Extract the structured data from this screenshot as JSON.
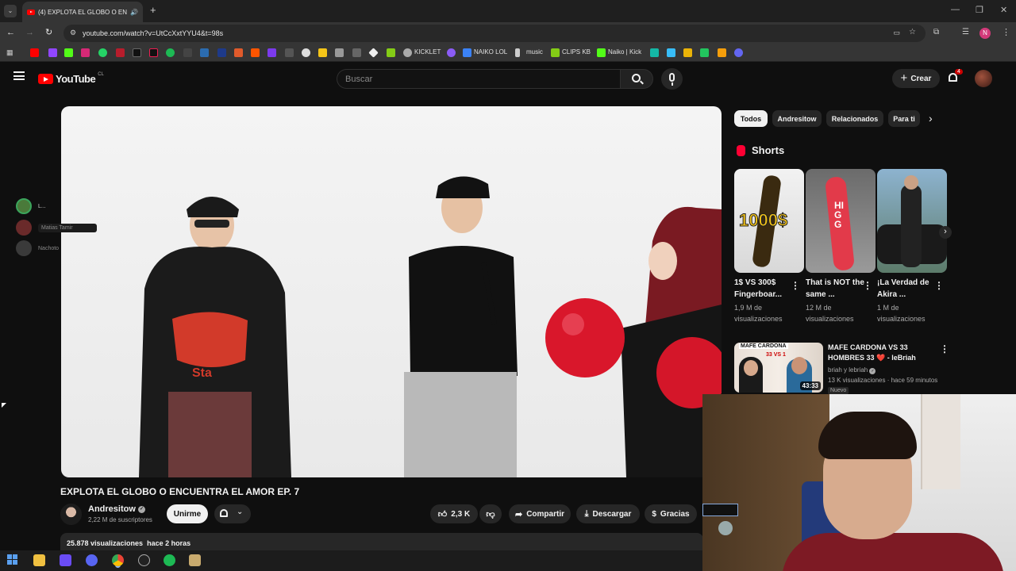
{
  "browser": {
    "tab_title": "(4) EXPLOTA EL GLOBO O EN",
    "url": "youtube.com/watch?v=UtCcXxtYYU4&t=98s",
    "profile_initial": "N",
    "bookmarks": [
      "KICKLET",
      "NAIKO LOL",
      "music",
      "CLIPS KB",
      "Naiko | Kick"
    ]
  },
  "youtube": {
    "logo_text": "YouTube",
    "region": "CL",
    "search_placeholder": "Buscar",
    "create_label": "Crear",
    "notification_count": "4"
  },
  "video": {
    "title": "EXPLOTA EL GLOBO O ENCUENTRA EL AMOR EP. 7",
    "channel": "Andresitow",
    "subscribers": "2,22 M de suscriptores",
    "join_label": "Unirme",
    "likes": "2,3 K",
    "share_label": "Compartir",
    "download_label": "Descargar",
    "thanks_label": "Gracias",
    "views": "25.878 visualizaciones",
    "published": "hace 2 horas"
  },
  "sidebar": {
    "chips": [
      "Todos",
      "Andresitow",
      "Relacionados",
      "Para ti"
    ],
    "shorts_heading": "Shorts",
    "shorts": [
      {
        "title": "1$ VS 300$ Fingerboar...",
        "views": "1,9 M de visualizaciones",
        "thumb_text": "1000$"
      },
      {
        "title": "That is NOT the same ...",
        "views": "12 M de visualizaciones",
        "thumb_text": "HIGG"
      },
      {
        "title": "¡La Verdad de Akira ...",
        "views": "1 M de visualizaciones",
        "thumb_text": ""
      }
    ],
    "recommended": {
      "title": "MAFE CARDONA VS 33 HOMBRES 33 ❤️ - leBriah",
      "channel": "briah y lebriah",
      "meta": "13 K visualizaciones · hace 59 minutos",
      "badge": "Nuevo",
      "duration": "43:33",
      "thumb_text_top": "MAFE CARDONA",
      "thumb_text_sub": "33 VS 1"
    }
  },
  "discord_overlay": [
    {
      "name": "L..."
    },
    {
      "name": "Matias Tamir"
    },
    {
      "name": "Nachoto"
    }
  ]
}
